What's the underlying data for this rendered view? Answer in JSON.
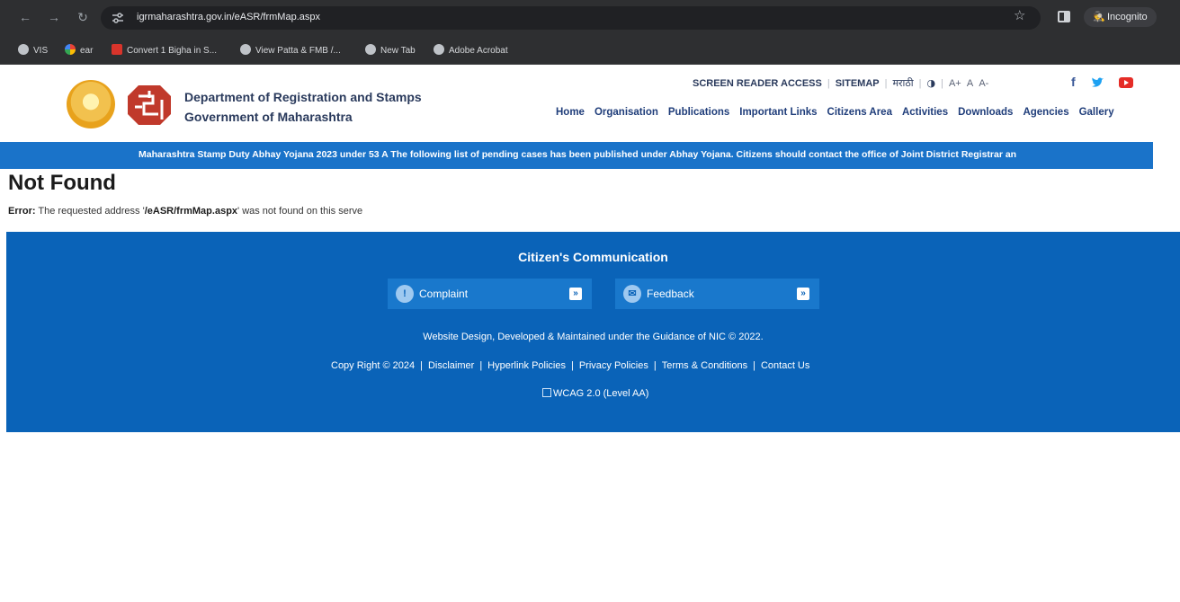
{
  "browser": {
    "url": "igrmaharashtra.gov.in/eASR/frmMap.aspx",
    "incognito_label": "Incognito",
    "bookmarks": [
      {
        "label": "VIS"
      },
      {
        "label": "ear"
      },
      {
        "label": "Convert 1 Bigha in S..."
      },
      {
        "label": "View Patta & FMB /..."
      },
      {
        "label": "New Tab"
      },
      {
        "label": "Adobe Acrobat"
      }
    ]
  },
  "header": {
    "title_line1": "Department of Registration and Stamps",
    "title_line2": "Government of Maharashtra",
    "utility": {
      "screen_reader": "SCREEN READER ACCESS",
      "sitemap": "SITEMAP",
      "language": "मराठी",
      "contrast": "◑",
      "font_up": "A+",
      "font_normal": "A",
      "font_down": "A-"
    },
    "nav": [
      "Home",
      "Organisation",
      "Publications",
      "Important Links",
      "Citizens Area",
      "Activities",
      "Downloads",
      "Agencies",
      "Gallery"
    ]
  },
  "marquee": {
    "text": "Maharashtra Stamp Duty Abhay Yojana 2023 under 53 A The following list of pending cases has been published under Abhay Yojana. Citizens should contact the office of Joint District Registrar an"
  },
  "error": {
    "title": "Not Found",
    "label": "Error:",
    "message_pre": "The requested address '",
    "path": "/eASR/frmMap.aspx",
    "message_post": "' was not found on this serve"
  },
  "footer": {
    "title": "Citizen's Communication",
    "complaint_label": "Complaint",
    "feedback_label": "Feedback",
    "credit": "Website Design, Developed & Maintained under the Guidance of NIC © 2022.",
    "links": [
      "Copy Right © 2024",
      "Disclaimer",
      "Hyperlink Policies",
      "Privacy Policies",
      "Terms & Conditions",
      "Contact Us"
    ],
    "wcag": "WCAG 2.0 (Level AA)"
  },
  "colors": {
    "chrome": "#2e2f31",
    "brand_blue": "#0a63b8",
    "marquee_blue": "#1a73c9",
    "nav_text": "#1f3d7a",
    "facebook": "#3b5998",
    "twitter": "#1da1f2",
    "youtube": "#e52d27"
  }
}
